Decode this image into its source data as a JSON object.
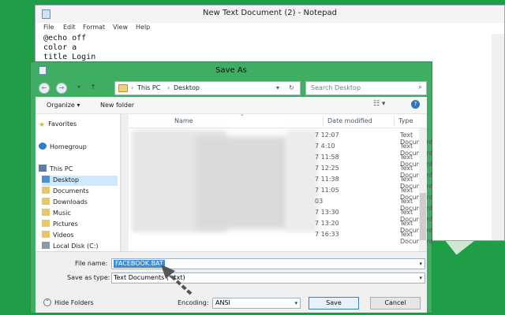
{
  "notepad": {
    "title": "New Text Document (2) - Notepad",
    "menu": [
      "File",
      "Edit",
      "Format",
      "View",
      "Help"
    ],
    "lines": [
      "@echo off",
      "color a",
      "title Login"
    ]
  },
  "dialog": {
    "title": "Save As",
    "breadcrumb": [
      "This PC",
      "Desktop"
    ],
    "search_placeholder": "Search Desktop",
    "toolbar": {
      "organize": "Organize ▾",
      "new_folder": "New folder"
    },
    "nav": {
      "favorites": "Favorites",
      "homegroup": "Homegroup",
      "this_pc": "This PC",
      "items": [
        "Desktop",
        "Documents",
        "Downloads",
        "Music",
        "Pictures",
        "Videos",
        "Local Disk (C:)"
      ],
      "selected": "Desktop"
    },
    "columns": {
      "name": "Name",
      "date": "Date modified",
      "type": "Type"
    },
    "rows": [
      {
        "date": "7 12:07",
        "type": "Text Document"
      },
      {
        "date": "7 4:10",
        "type": "Text Document"
      },
      {
        "date": "7 11:58",
        "type": "Text Document"
      },
      {
        "date": "7 12:25",
        "type": "Text Document"
      },
      {
        "date": "7 11:38",
        "type": "Text Document"
      },
      {
        "date": "7 11:05",
        "type": "Text Document"
      },
      {
        "date": "03",
        "type": "Text Document"
      },
      {
        "date": "7 13:30",
        "type": "Text Document"
      },
      {
        "date": "7 13:20",
        "type": "Text Document"
      },
      {
        "date": "7 16:33",
        "type": "Text Document"
      }
    ],
    "filename_label": "File name:",
    "filename_value": "FACEBOOK.BAT",
    "savetype_label": "Save as type:",
    "savetype_value": "Text Documents (*.txt)",
    "hide_folders": "Hide Folders",
    "encoding_label": "Encoding:",
    "encoding_value": "ANSI",
    "save": "Save",
    "cancel": "Cancel"
  },
  "colors": {
    "desktop": "#1f9e47",
    "dialog_frame": "#3fae62",
    "selection": "#3b8cd8"
  }
}
